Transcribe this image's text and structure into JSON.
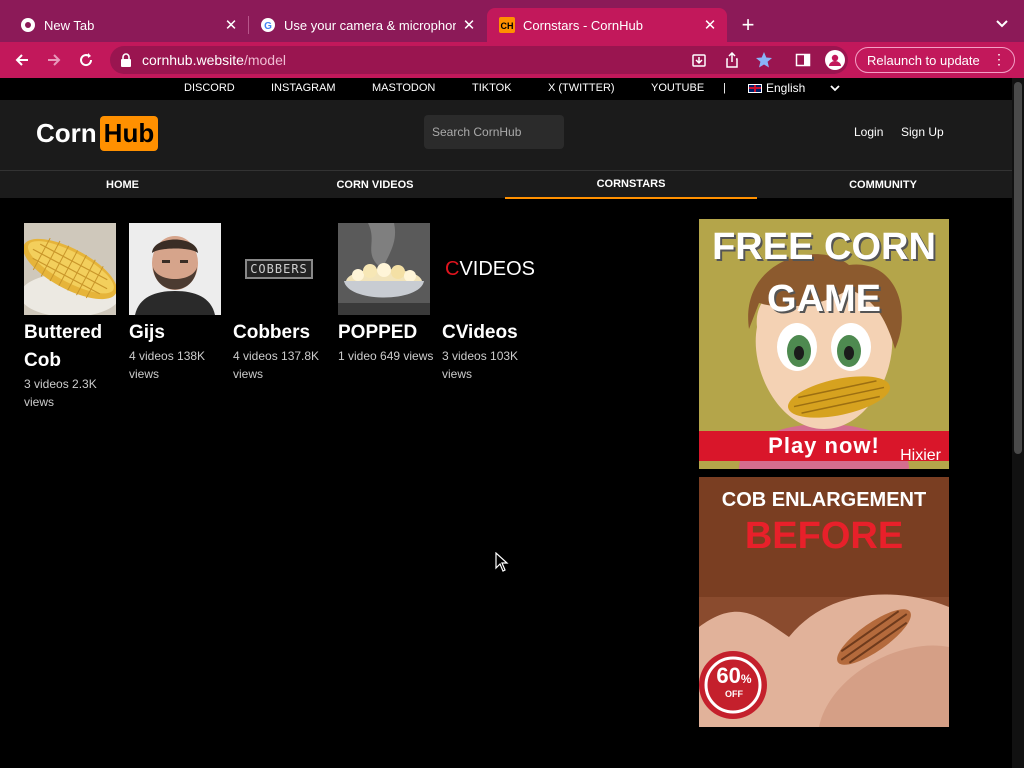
{
  "browser": {
    "tabs": [
      {
        "title": "New Tab",
        "icon": "chrome-icon"
      },
      {
        "title": "Use your camera & microphone",
        "icon": "google-icon"
      },
      {
        "title": "Cornstars - CornHub",
        "icon": "cornhub-favicon-icon",
        "active": true
      }
    ],
    "url_host": "cornhub.website",
    "url_path": "/model",
    "relaunch_label": "Relaunch to update",
    "accent": "#c2185b"
  },
  "social": {
    "links": [
      "DISCORD",
      "INSTAGRAM",
      "MASTODON",
      "TIKTOK",
      "X (TWITTER)",
      "YOUTUBE"
    ],
    "separator": "|",
    "language": "English"
  },
  "header": {
    "logo_corn": "Corn",
    "logo_hub": "Hub",
    "search_placeholder": "Search CornHub",
    "login": "Login",
    "signup": "Sign Up"
  },
  "nav": [
    "HOME",
    "CORN VIDEOS",
    "CORNSTARS",
    "COMMUNITY"
  ],
  "models": [
    {
      "name": "Buttered Cob",
      "stats": "3 videos 2.3K views"
    },
    {
      "name": "Gijs",
      "stats": "4 videos 138K views"
    },
    {
      "name": "Cobbers",
      "stats": "4 videos 137.8K views"
    },
    {
      "name": "POPPED",
      "stats": "1 video 649 views"
    },
    {
      "name": "CVideos",
      "stats": "3 videos 103K views"
    }
  ],
  "thumb_text": {
    "cobbers": "COBBERS",
    "cvideos_c": "C",
    "cvideos_rest": "VIDEOS"
  },
  "ads": {
    "game": {
      "headline": "FREE CORN GAME",
      "cta": "Play now!",
      "brand": "Hixier"
    },
    "enlarge": {
      "headline": "COB ENLARGEMENT",
      "sub": "BEFORE",
      "badge_pct": "60",
      "badge_sym": "%",
      "badge_off": "OFF"
    }
  }
}
